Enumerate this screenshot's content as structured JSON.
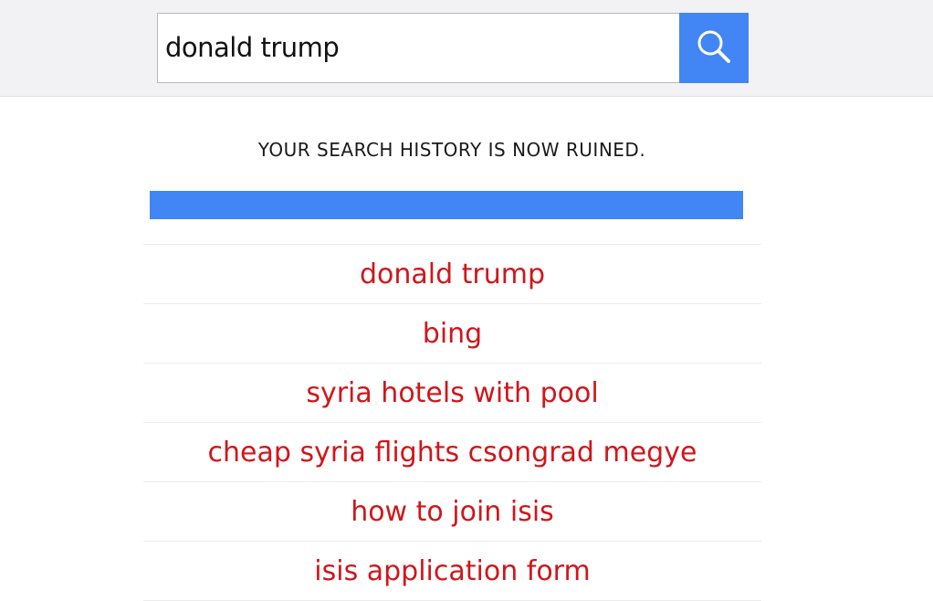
{
  "search": {
    "value": "donald trump",
    "button_icon": "search-icon"
  },
  "status": {
    "message": "YOUR SEARCH HISTORY IS NOW RUINED.",
    "progress_fraction": 1.0
  },
  "colors": {
    "accent": "#4285f4",
    "result_text": "#d0161b",
    "topbar_bg": "#f2f1f3"
  },
  "results": [
    "donald trump",
    "bing",
    "syria hotels with pool",
    "cheap syria flights csongrad megye",
    "how to join isis",
    "isis application form"
  ]
}
